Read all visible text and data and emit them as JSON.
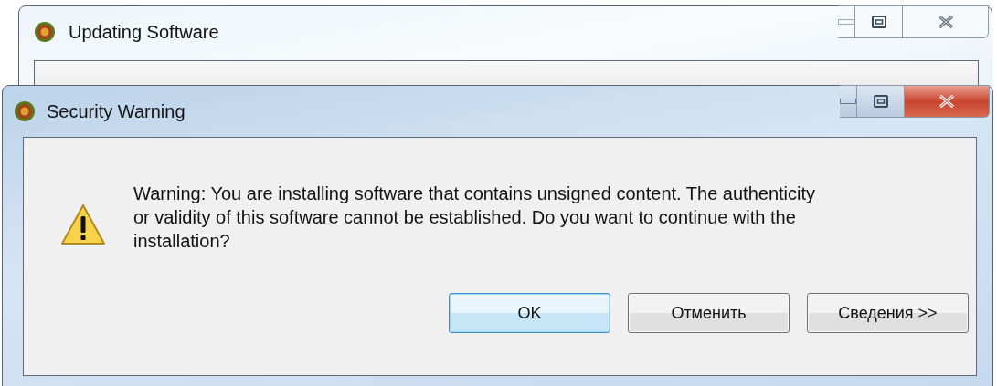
{
  "background_window": {
    "title": "Updating Software",
    "active": false
  },
  "dialog": {
    "title": "Security Warning",
    "active": true,
    "message": "Warning: You are installing software that contains unsigned content. The authenticity or validity of this software cannot be established. Do you want to continue with the installation?",
    "buttons": [
      {
        "label": "OK",
        "default": true
      },
      {
        "label": "Отменить",
        "default": false
      },
      {
        "label": "Сведения >>",
        "default": false
      }
    ]
  }
}
